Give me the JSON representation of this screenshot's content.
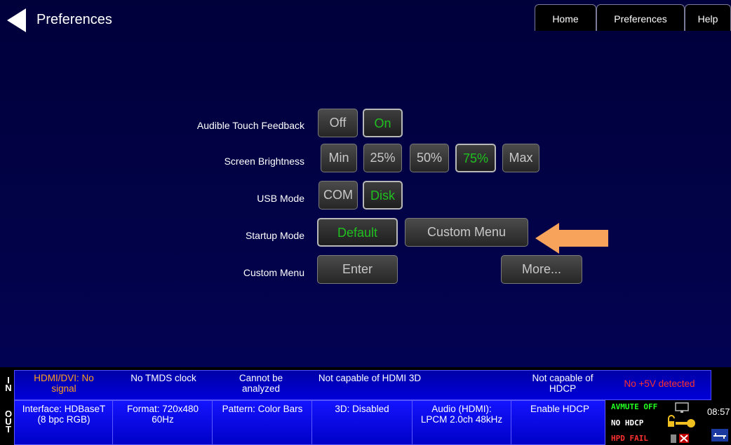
{
  "header": {
    "title": "Preferences",
    "tabs": [
      {
        "label": "Home"
      },
      {
        "label": "Preferences"
      },
      {
        "label": "Help"
      }
    ]
  },
  "settings": {
    "audible": {
      "label": "Audible Touch Feedback",
      "options": [
        "Off",
        "On"
      ],
      "selected": "On"
    },
    "brightness": {
      "label": "Screen Brightness",
      "options": [
        "Min",
        "25%",
        "50%",
        "75%",
        "Max"
      ],
      "selected": "75%"
    },
    "usb": {
      "label": "USB Mode",
      "options": [
        "COM",
        "Disk"
      ],
      "selected": "Disk"
    },
    "startup": {
      "label": "Startup Mode",
      "options": [
        "Default",
        "Custom Menu"
      ],
      "selected": "Default"
    },
    "custom_menu": {
      "label": "Custom Menu",
      "enter": "Enter",
      "more": "More..."
    }
  },
  "status": {
    "in_label": "I\nN",
    "out_label": "O\nU\nT",
    "in_cells": [
      "HDMI/DVI: No signal",
      "No TMDS clock",
      "Cannot be analyzed",
      "Not capable of HDMI 3D",
      "Not capable of HDCP",
      "No +5V detected"
    ],
    "out_cells": [
      "Interface: HDBaseT (8 bpc RGB)",
      "Format: 720x480 60Hz",
      "Pattern: Color Bars",
      "3D: Disabled",
      "Audio (HDMI): LPCM 2.0ch 48kHz",
      "Enable HDCP"
    ],
    "indicators": {
      "avmute": "AVMUTE OFF",
      "hdcp": "NO HDCP",
      "hpd": "HPD FAIL"
    },
    "clock": "08:57"
  },
  "colors": {
    "selected_text": "#20c020",
    "warning_text": "#ff3030",
    "indicator_green": "#20ff20",
    "orange_arrow": "#f7a35c"
  }
}
